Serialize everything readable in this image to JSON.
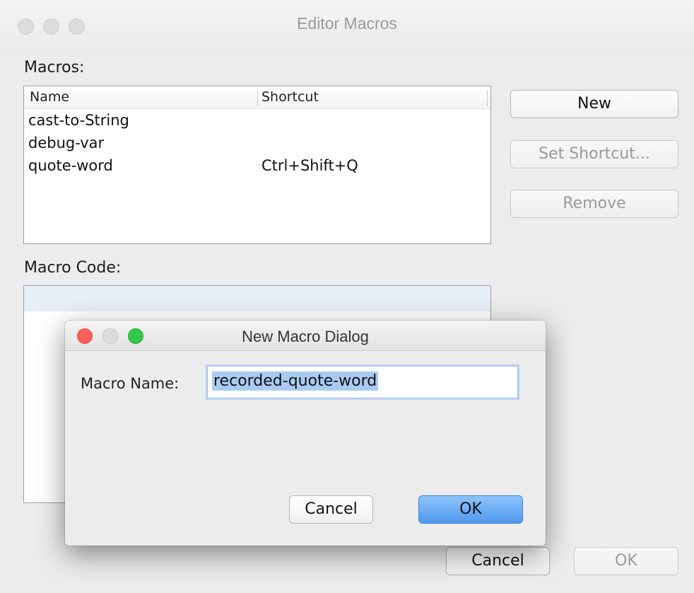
{
  "window": {
    "title": "Editor Macros"
  },
  "macros": {
    "section_label": "Macros:",
    "columns": [
      "Name",
      "Shortcut"
    ],
    "rows": [
      {
        "name": "cast-to-String",
        "shortcut": ""
      },
      {
        "name": "debug-var",
        "shortcut": ""
      },
      {
        "name": "quote-word",
        "shortcut": "Ctrl+Shift+Q"
      }
    ]
  },
  "side_buttons": {
    "new_label": "New",
    "set_shortcut_label": "Set Shortcut...",
    "remove_label": "Remove"
  },
  "macro_code": {
    "section_label": "Macro Code:"
  },
  "footer": {
    "cancel_label": "Cancel",
    "ok_label": "OK"
  },
  "dialog": {
    "title": "New Macro Dialog",
    "field_label": "Macro Name:",
    "field_value": "recorded-quote-word",
    "cancel_label": "Cancel",
    "ok_label": "OK"
  },
  "colors": {
    "window_bg": "#ececec",
    "close_red": "#fc605c",
    "zoom_green": "#34c84a",
    "inactive_gray": "#dcdcdc",
    "selection_blue": "#a9cbf3",
    "default_button_blue": "#4f98ee"
  }
}
